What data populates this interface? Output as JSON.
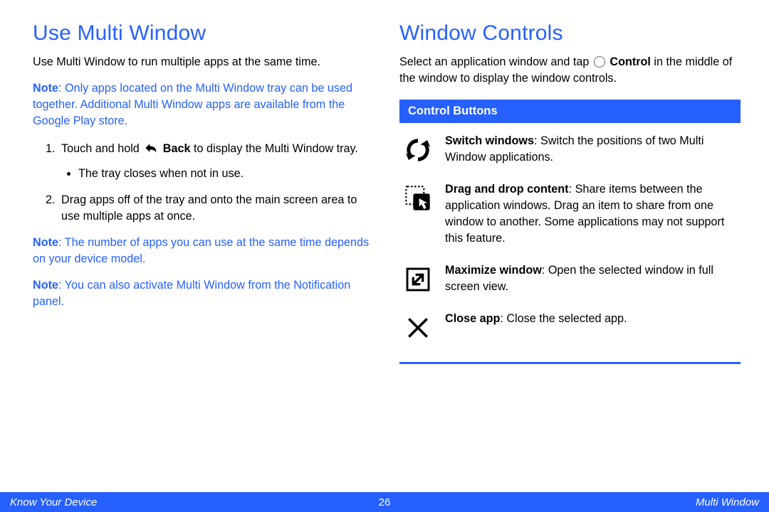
{
  "left": {
    "heading": "Use Multi Window",
    "intro": "Use Multi Window to run multiple apps at the same time.",
    "note1_label": "Note",
    "note1": ": Only apps located on the Multi Window tray can be used together. Additional Multi Window apps are available from the Google Play store.",
    "step1_pre": "Touch and hold ",
    "step1_bold": " Back",
    "step1_post": " to display the Multi Window tray.",
    "step1_sub": "The tray closes when not in use.",
    "step2": "Drag apps off of the tray and onto the main screen area to use multiple apps at once.",
    "note2_label": "Note",
    "note2": ": The number of apps you can use at the same time depends on your device model.",
    "note3_label": "Note",
    "note3": ": You can also activate Multi Window from the Notification panel."
  },
  "right": {
    "heading": "Window Controls",
    "intro_pre": "Select an application window and tap ",
    "intro_bold": " Control",
    "intro_post": " in the middle of the window to display the window controls.",
    "section_title": "Control Buttons",
    "items": [
      {
        "title": "Switch windows",
        "desc": ": Switch the positions of two Multi Window applications."
      },
      {
        "title": "Drag and drop content",
        "desc": ": Share items between the application windows. Drag an item to share from one window to another. Some applications may not support this feature."
      },
      {
        "title": "Maximize window",
        "desc": ": Open the selected window in full screen view."
      },
      {
        "title": "Close app",
        "desc": ": Close the selected app."
      }
    ]
  },
  "footer": {
    "left": "Know Your Device",
    "center": "26",
    "right": "Multi Window"
  }
}
